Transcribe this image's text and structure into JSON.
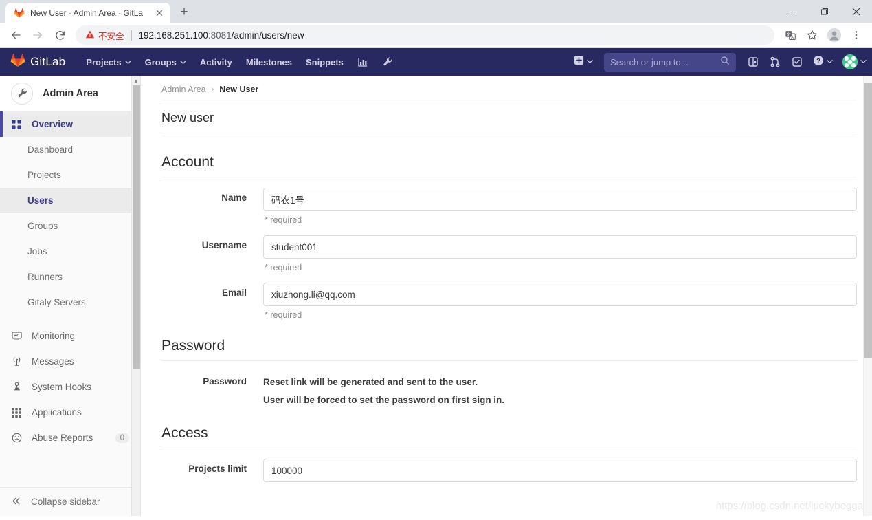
{
  "browser": {
    "tab": {
      "title": "New User · Admin Area · GitLa",
      "favicon": "gitlab-fox-icon",
      "close": "✕"
    },
    "new_tab_label": "+",
    "window_controls": {
      "minimize": "minimize-icon",
      "maximize": "maximize-icon",
      "close": "close-icon"
    },
    "nav": {
      "back": "back-arrow-icon",
      "forward": "forward-arrow-icon",
      "reload": "reload-icon"
    },
    "omnibox": {
      "security_warning": "不安全",
      "security_icon": "warning-triangle-icon",
      "url_host": "192.168.251.100",
      "url_port": ":8081",
      "url_path": "/admin/users/new"
    },
    "toolbar_icons": [
      "translate-icon",
      "bookmark-star-icon",
      "profile-avatar-icon",
      "three-dot-menu-icon"
    ]
  },
  "gitlab_nav": {
    "brand": "GitLab",
    "menu": [
      {
        "label": "Projects",
        "caret": true
      },
      {
        "label": "Groups",
        "caret": true
      },
      {
        "label": "Activity",
        "caret": false
      },
      {
        "label": "Milestones",
        "caret": false
      },
      {
        "label": "Snippets",
        "caret": false
      }
    ],
    "icon_links": [
      "analytics-chart-icon",
      "admin-wrench-icon"
    ],
    "create_new": {
      "icon": "plus-square-icon",
      "caret": "▾"
    },
    "search_placeholder": "Search or jump to...",
    "search_icon": "search-icon",
    "right_icons": [
      "issues-icon",
      "merge-requests-icon",
      "todos-icon"
    ],
    "help": {
      "icon": "help-circle-icon",
      "caret": "▾"
    },
    "user": {
      "avatar": "user-avatar",
      "caret": "▾"
    }
  },
  "sidebar": {
    "header": {
      "title": "Admin Area",
      "icon": "wrench-icon"
    },
    "overview": {
      "label": "Overview",
      "icon": "grid-icon"
    },
    "sub_items": [
      {
        "label": "Dashboard",
        "active": false
      },
      {
        "label": "Projects",
        "active": false
      },
      {
        "label": "Users",
        "active": true
      },
      {
        "label": "Groups",
        "active": false
      },
      {
        "label": "Jobs",
        "active": false
      },
      {
        "label": "Runners",
        "active": false
      },
      {
        "label": "Gitaly Servers",
        "active": false
      }
    ],
    "items": [
      {
        "label": "Monitoring",
        "icon": "monitor-icon",
        "badge": null
      },
      {
        "label": "Messages",
        "icon": "broadcast-icon",
        "badge": null
      },
      {
        "label": "System Hooks",
        "icon": "hook-icon",
        "badge": null
      },
      {
        "label": "Applications",
        "icon": "applications-grid-icon",
        "badge": null
      },
      {
        "label": "Abuse Reports",
        "icon": "frown-face-icon",
        "badge": "0"
      }
    ],
    "collapse": {
      "label": "Collapse sidebar",
      "icon": "double-chevron-left-icon"
    }
  },
  "main": {
    "breadcrumb": {
      "root": "Admin Area",
      "separator": "›",
      "current": "New User"
    },
    "page_title": "New user",
    "sections": {
      "account": {
        "title": "Account",
        "fields": [
          {
            "label": "Name",
            "value": "码农1号",
            "hint": "* required"
          },
          {
            "label": "Username",
            "value": "student001",
            "hint": "* required"
          },
          {
            "label": "Email",
            "value": "xiuzhong.li@qq.com",
            "hint": "* required"
          }
        ]
      },
      "password": {
        "title": "Password",
        "label": "Password",
        "note_line1": "Reset link will be generated and sent to the user.",
        "note_line2": "User will be forced to set the password on first sign in."
      },
      "access": {
        "title": "Access",
        "fields": [
          {
            "label": "Projects limit",
            "value": "100000"
          }
        ]
      }
    },
    "watermark": "https://blog.csdn.net/luckybeggar"
  },
  "colors": {
    "gitlab_navy": "#292961",
    "gitlab_orange": "#e24329",
    "accent_purple": "#4b4ba3",
    "warning_red": "#d93025"
  }
}
